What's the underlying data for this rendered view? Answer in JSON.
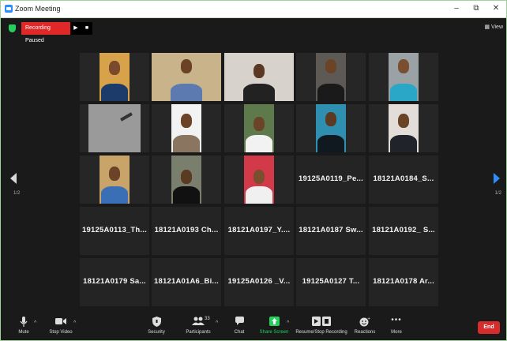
{
  "window": {
    "title": "Zoom Meeting",
    "minimize": "–",
    "restore": "⧉",
    "close": "✕"
  },
  "recording": {
    "status": "Recording Paused",
    "resume_icon": "play-icon",
    "stop_icon": "stop-icon"
  },
  "view": {
    "label": "View"
  },
  "pager": {
    "left": "1/2",
    "right": "1/2"
  },
  "tiles": [
    {
      "type": "video",
      "name": ""
    },
    {
      "type": "video",
      "name": ""
    },
    {
      "type": "video",
      "name": ""
    },
    {
      "type": "video",
      "name": ""
    },
    {
      "type": "video",
      "name": ""
    },
    {
      "type": "video",
      "name": ""
    },
    {
      "type": "video",
      "name": ""
    },
    {
      "type": "video",
      "name": ""
    },
    {
      "type": "video",
      "name": ""
    },
    {
      "type": "video",
      "name": ""
    },
    {
      "type": "video",
      "name": ""
    },
    {
      "type": "video",
      "name": ""
    },
    {
      "type": "video",
      "name": ""
    },
    {
      "type": "name",
      "name": "19125A0119_Pe..."
    },
    {
      "type": "name",
      "name": "18121A0184_S..."
    },
    {
      "type": "name",
      "name": "19125A0113_Th..."
    },
    {
      "type": "name",
      "name": "18121A0193  Ch..."
    },
    {
      "type": "name",
      "name": "18121A0197_Y...."
    },
    {
      "type": "name",
      "name": "18121A0187  Sw..."
    },
    {
      "type": "name",
      "name": "18121A0192_  S..."
    },
    {
      "type": "name",
      "name": "18121A0179  Sa..."
    },
    {
      "type": "name",
      "name": "18121A01A6_Bi..."
    },
    {
      "type": "name",
      "name": "19125A0126  _V..."
    },
    {
      "type": "name",
      "name": "19125A0127  T..."
    },
    {
      "type": "name",
      "name": "18121A0178  Ar..."
    }
  ],
  "toolbar": {
    "mute": "Mute",
    "stop_video": "Stop Video",
    "security": "Security",
    "participants": "Participants",
    "participants_count": "33",
    "chat": "Chat",
    "share_screen": "Share Screen",
    "record": "Resume/Stop Recording",
    "reactions": "Reactions",
    "more": "More",
    "end": "End"
  },
  "colors": {
    "accent": "#2d8cff",
    "share": "#23d15c",
    "record": "#e02828",
    "end": "#d62c2c",
    "highlight": "#c6e24a"
  }
}
